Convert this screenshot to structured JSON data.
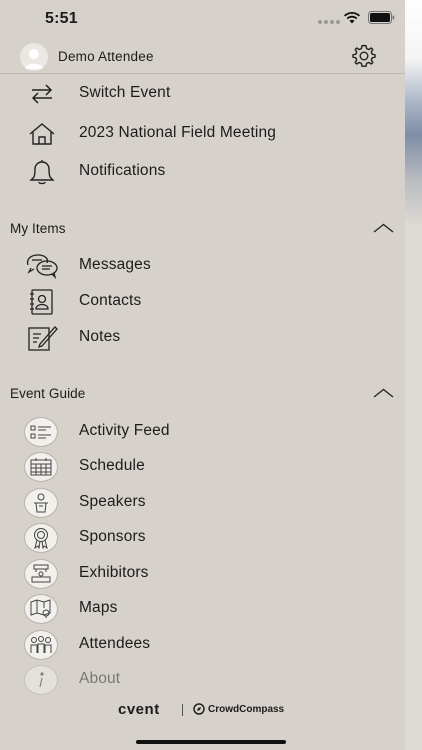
{
  "status": {
    "time": "5:51"
  },
  "header": {
    "username": "Demo Attendee"
  },
  "top_items": [
    {
      "label": "Switch Event",
      "icon": "switch-arrows-icon"
    },
    {
      "label": "2023 National Field Meeting",
      "icon": "home-icon"
    },
    {
      "label": "Notifications",
      "icon": "bell-icon"
    }
  ],
  "my_items": {
    "title": "My Items",
    "items": [
      {
        "label": "Messages",
        "icon": "messages-icon"
      },
      {
        "label": "Contacts",
        "icon": "contacts-icon"
      },
      {
        "label": "Notes",
        "icon": "notes-icon"
      }
    ]
  },
  "event_guide": {
    "title": "Event Guide",
    "items": [
      {
        "label": "Activity Feed",
        "icon": "activity-feed-icon"
      },
      {
        "label": "Schedule",
        "icon": "calendar-icon"
      },
      {
        "label": "Speakers",
        "icon": "speaker-icon"
      },
      {
        "label": "Sponsors",
        "icon": "ribbon-icon"
      },
      {
        "label": "Exhibitors",
        "icon": "booth-icon"
      },
      {
        "label": "Maps",
        "icon": "map-icon"
      },
      {
        "label": "Attendees",
        "icon": "people-icon"
      },
      {
        "label": "About",
        "icon": "info-icon"
      }
    ]
  },
  "footer": {
    "brand": "cvent",
    "partner": "CrowdCompass"
  }
}
